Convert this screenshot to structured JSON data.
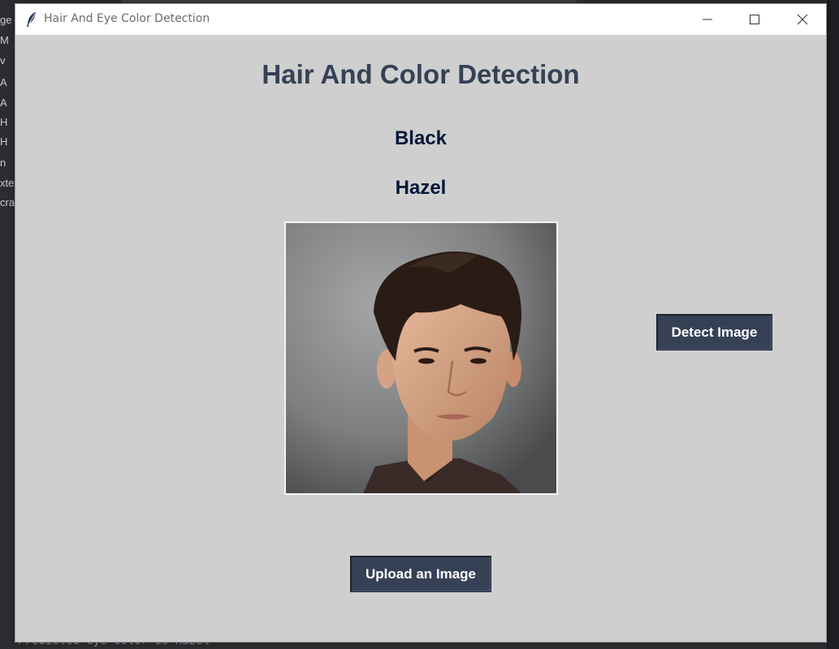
{
  "window": {
    "title": "Hair And Eye Color Detection"
  },
  "app": {
    "heading": "Hair And Color Detection",
    "hair_result": "Black",
    "eye_result": "Hazel",
    "photo": "uploaded-face-photo",
    "detect_label": "Detect Image",
    "upload_label": "Upload an Image"
  },
  "background_ide": {
    "left_rows": [
      "ge",
      "M",
      "v",
      "A",
      "A",
      "H",
      "H",
      "n",
      "xte",
      "cra"
    ],
    "bottom_console": "Predicted eye color is Hazel"
  },
  "colors": {
    "window_bg": "#cfcfcf",
    "accent": "#364156",
    "result_text": "#011638"
  }
}
